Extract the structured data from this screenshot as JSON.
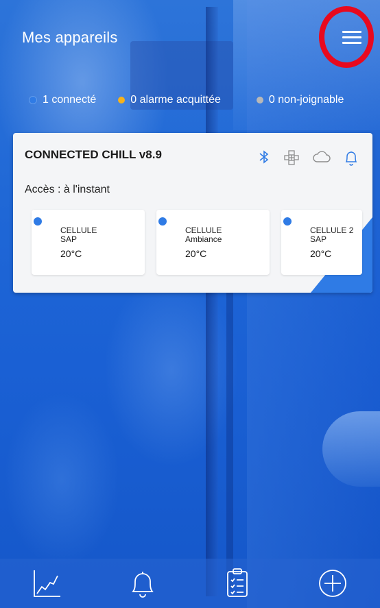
{
  "header": {
    "title": "Mes appareils",
    "menu_icon": "hamburger-menu-icon"
  },
  "status": {
    "connected": "1 connecté",
    "alarm": "0 alarme acquittée",
    "unreachable": "0 non-joignable"
  },
  "device": {
    "name": "CONNECTED CHILL v8.9",
    "access": "Accès : à l'instant",
    "icons": [
      "bluetooth-icon",
      "network-icon",
      "cloud-icon",
      "bell-icon"
    ],
    "cells": [
      {
        "name": "CELLULE",
        "sub": "SAP",
        "temp": "20°C"
      },
      {
        "name": "CELLULE",
        "sub": "Ambiance",
        "temp": "20°C"
      },
      {
        "name": "CELLULE 2",
        "sub": "SAP",
        "temp": "20°C"
      }
    ]
  },
  "bottom_nav": {
    "items": [
      "chart-icon",
      "bell-icon",
      "clipboard-checklist-icon",
      "add-circle-icon"
    ]
  },
  "colors": {
    "accent": "#2f7be5",
    "alarm": "#f6b21b",
    "unreachable": "#b8b8b8",
    "highlight": "#e8091e"
  }
}
